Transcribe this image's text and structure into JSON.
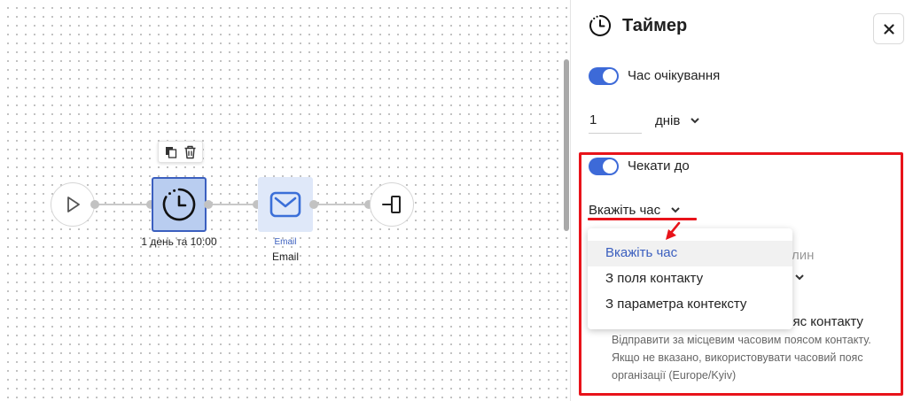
{
  "flow": {
    "timer_caption": "1 день та 10:00",
    "email_subcaption": "Email",
    "email_caption": "Email"
  },
  "panel": {
    "title": "Таймер",
    "wait_time_label": "Час очікування",
    "wait_amount_value": "1",
    "wait_unit_label": "днів",
    "wait_until_label": "Чекати до",
    "time_select_label": "Вкажіть час",
    "time_options": [
      "Вкажіть час",
      "З поля контакту",
      "З параметра контексту"
    ],
    "hidden_text_fragment": "лин",
    "contact_timezone_fragment": "пояс контакту",
    "contact_timezone_help": "Відправити за місцевим часовим поясом контакту. Якщо не вказано, використовувати часовий пояс організації (Europe/Kyiv)"
  },
  "colors": {
    "accent": "#3d6ad8",
    "highlight_red": "#e8131a",
    "selected_node": "#b9cdf0"
  }
}
